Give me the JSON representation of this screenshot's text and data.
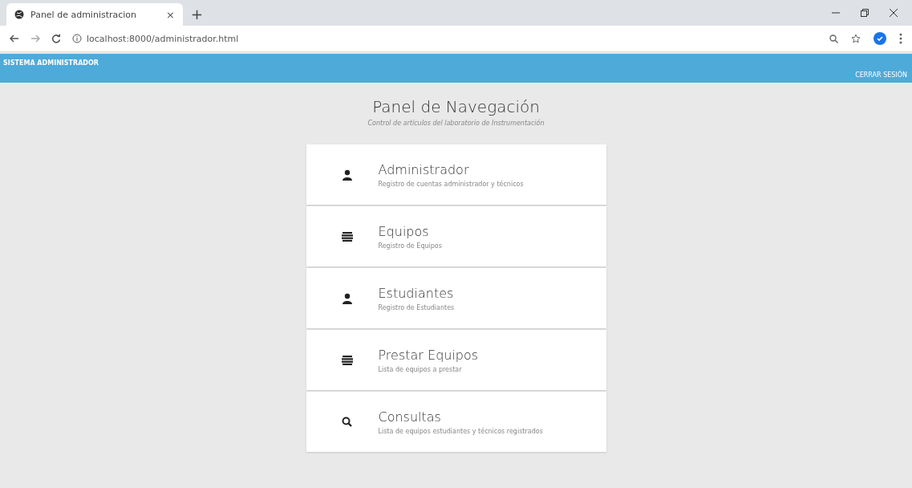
{
  "browser": {
    "tab_title": "Panel de administracion",
    "close_tab": "×",
    "new_tab": "+",
    "url": "localhost:8000/administrador.html"
  },
  "navbar": {
    "brand": "SISTEMA ADMINISTRADOR",
    "logout": "CERRAR SESIÓN"
  },
  "header": {
    "title": "Panel de Navegación",
    "subtitle": "Control de artículos del laboratorio de Instrumentación"
  },
  "cards": [
    {
      "kind": "user",
      "title": "Administrador",
      "description": "Registro de cuentas administrador y técnicos"
    },
    {
      "kind": "list",
      "title": "Equipos",
      "description": "Registro de Equipos"
    },
    {
      "kind": "user",
      "title": "Estudiantes",
      "description": "Registro de Estudiantes"
    },
    {
      "kind": "list",
      "title": "Prestar Equipos",
      "description": "Lista de equipos a prestar"
    },
    {
      "kind": "search",
      "title": "Consultas",
      "description": "Lista de equipos estudiantes y técnicos registrados"
    }
  ]
}
